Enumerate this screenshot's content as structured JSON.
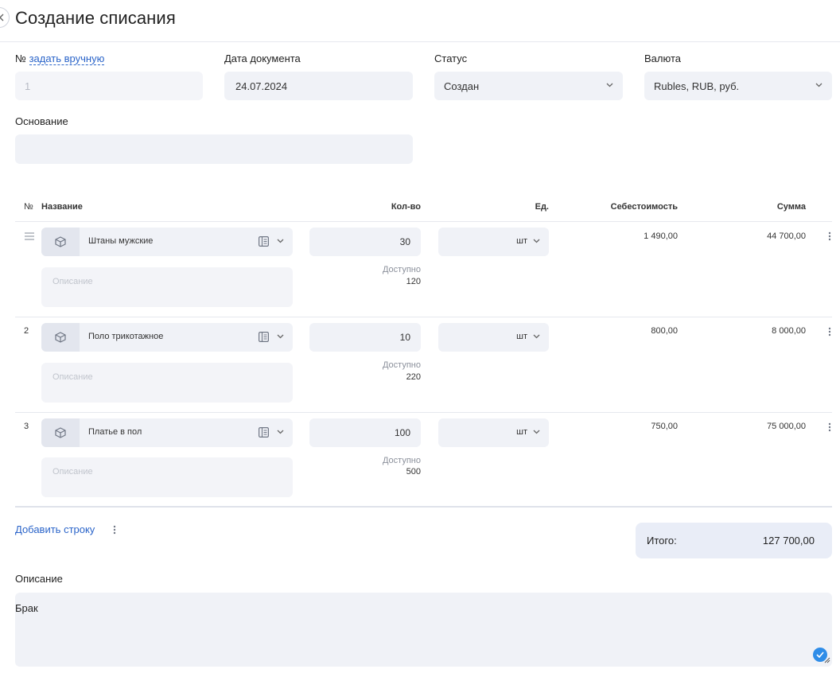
{
  "page": {
    "title": "Создание списания"
  },
  "header_fields": {
    "number_label": "№",
    "number_link": "задать вручную",
    "number_value": "1",
    "date_label": "Дата документа",
    "date_value": "24.07.2024",
    "status_label": "Статус",
    "status_value": "Создан",
    "currency_label": "Валюта",
    "currency_value": "Rubles, RUB, руб.",
    "basis_label": "Основание",
    "basis_value": ""
  },
  "table": {
    "columns": {
      "num": "№",
      "name": "Название",
      "qty": "Кол-во",
      "unit": "Ед.",
      "cost": "Себестоимость",
      "sum": "Сумма"
    },
    "description_placeholder": "Описание",
    "available_label": "Доступно",
    "rows": [
      {
        "num": "",
        "name": "Штаны мужские",
        "qty": "30",
        "available": "120",
        "unit": "шт",
        "cost": "1 490,00",
        "sum": "44 700,00"
      },
      {
        "num": "2",
        "name": "Поло трикотажное",
        "qty": "10",
        "available": "220",
        "unit": "шт",
        "cost": "800,00",
        "sum": "8 000,00"
      },
      {
        "num": "3",
        "name": "Платье в пол",
        "qty": "100",
        "available": "500",
        "unit": "шт",
        "cost": "750,00",
        "sum": "75 000,00"
      }
    ]
  },
  "footer": {
    "add_row": "Добавить строку",
    "total_label": "Итого:",
    "total_value": "127 700,00",
    "notes_label": "Описание",
    "notes_value": "Брак"
  },
  "colors": {
    "accent": "#2a64c9",
    "field_bg": "#f0f2f7",
    "total_bg": "#e9edf7"
  }
}
